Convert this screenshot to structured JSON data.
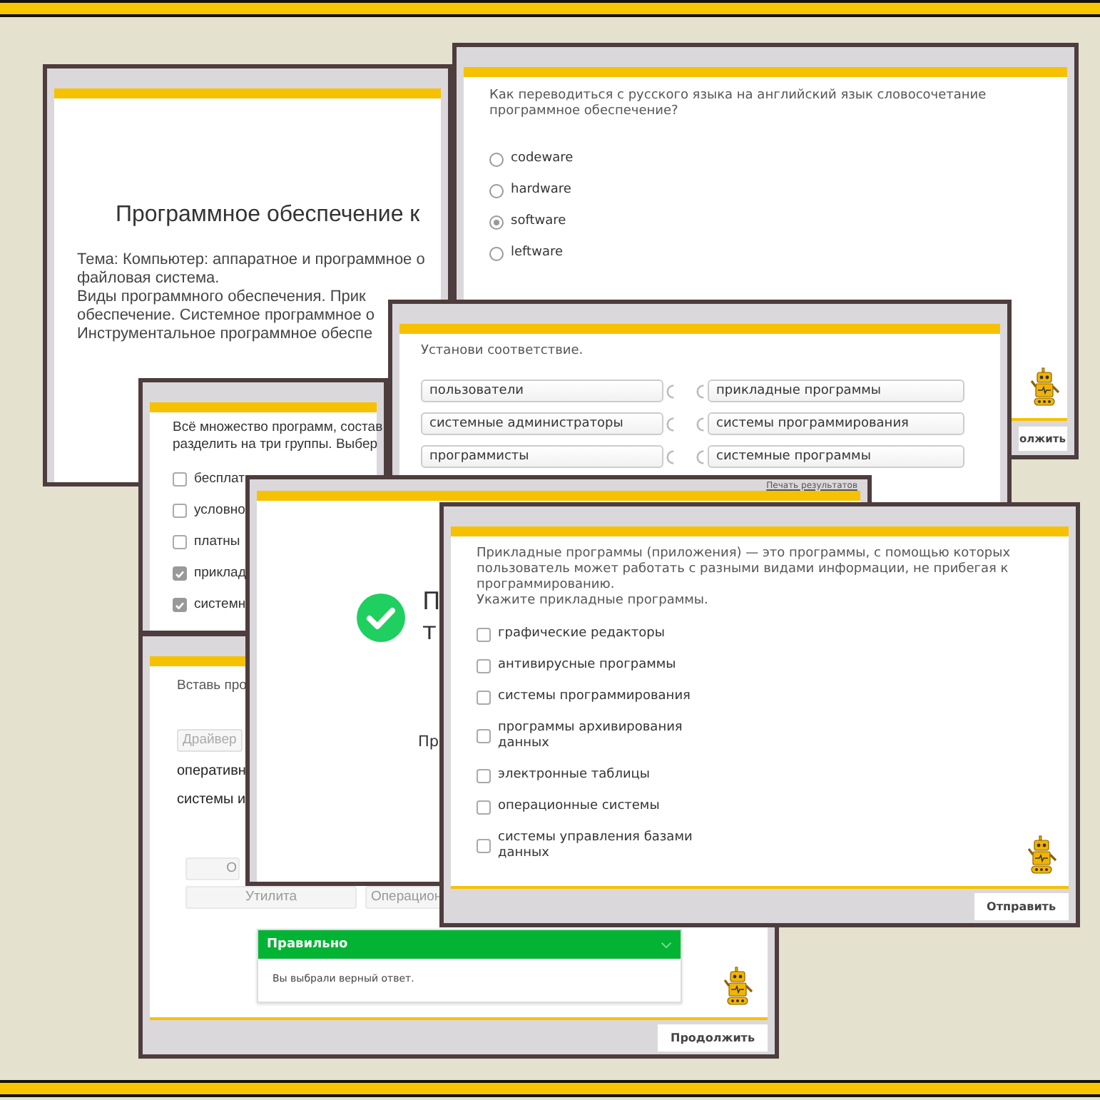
{
  "slide": {
    "title": "Программное обеспечение к",
    "lines": [
      "Тема: Компьютер: аппаратное и программное о",
      "файловая система.",
      "Виды программного обеспечения. Прик",
      "обеспечение. Системное программное о",
      "Инструментальное программное обеспе"
    ]
  },
  "translate_question": {
    "prompt": "Как переводиться с русского языка на английский язык словосочетание программное обеспечение?",
    "options": [
      {
        "label": "codeware",
        "selected": false
      },
      {
        "label": "hardware",
        "selected": false
      },
      {
        "label": "software",
        "selected": true
      },
      {
        "label": "leftware",
        "selected": false
      }
    ],
    "continue_button": "олжить"
  },
  "matching": {
    "prompt": "Установи соответствие.",
    "left": [
      "пользователи",
      "системные администраторы",
      "программисты"
    ],
    "right": [
      "прикладные программы",
      "системы программирования",
      "системные программы"
    ]
  },
  "groups_question": {
    "prompt_lines": [
      "Всё множество программ, состав",
      "разделить на три группы. Выбер"
    ],
    "options": [
      {
        "label": "бесплат",
        "checked": false
      },
      {
        "label": "условно",
        "checked": false
      },
      {
        "label": "платны",
        "checked": false
      },
      {
        "label": "приклад",
        "checked": true
      },
      {
        "label": "системн",
        "checked": true
      }
    ]
  },
  "insert_task": {
    "prompt": "Вставь про",
    "used_chip": "Драйвер",
    "lines": [
      "оперативн",
      "системы и"
    ],
    "chips": [
      "О",
      "Утилита",
      "Операцион"
    ],
    "feedback": {
      "title": "Правильно",
      "text": "Вы выбрали верный ответ."
    },
    "continue_button": "Продолжить"
  },
  "result": {
    "print_link": "Печать результатов",
    "title_lines": [
      "П",
      "т"
    ],
    "text": "Пр"
  },
  "applied_question": {
    "paragraphs": [
      "Прикладные программы (приложения) — это программы, с помощью которых пользователь может работать с разными видами информации, не прибегая к программированию.",
      "Укажите прикладные программы."
    ],
    "options": [
      {
        "label": "графические редакторы",
        "checked": false
      },
      {
        "label": "антивирусные программы",
        "checked": false
      },
      {
        "label": "системы программирования",
        "checked": false
      },
      {
        "label": "программы архивирования данных",
        "checked": false
      },
      {
        "label": "электронные таблицы",
        "checked": false
      },
      {
        "label": "операционные системы",
        "checked": false
      },
      {
        "label": "системы управления базами данных",
        "checked": false
      }
    ],
    "submit_button": "Отправить"
  }
}
